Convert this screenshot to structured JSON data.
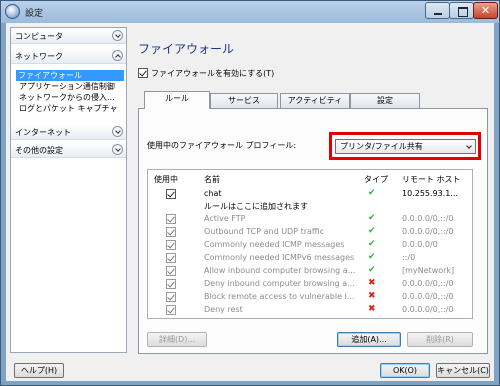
{
  "window": {
    "title": "設定"
  },
  "sidebar": {
    "sections": [
      {
        "label": "コンピュータ",
        "expanded": false
      },
      {
        "label": "ネットワーク",
        "expanded": true,
        "items": [
          "ファイアウォール",
          "アプリケーション通信制御",
          "ネットワークからの侵入...",
          "ログとパケット キャプチャ"
        ],
        "selected_index": 0
      },
      {
        "label": "インターネット",
        "expanded": false
      },
      {
        "label": "その他の設定",
        "expanded": false
      }
    ]
  },
  "main": {
    "title": "ファイアウォール",
    "enable_firewall": {
      "label": "ファイアウォールを有効にする(T)",
      "checked": true
    },
    "tabs": [
      "ルール",
      "サービス",
      "アクティビティ",
      "設定"
    ],
    "active_tab": 0,
    "profile": {
      "label": "使用中のファイアウォール プロフィール:",
      "value": "プリンタ/ファイル共有"
    },
    "rules": {
      "columns": [
        "使用中",
        "名前",
        "タイプ",
        "リモート ホスト"
      ],
      "rows": [
        {
          "enabled": true,
          "name": "chat",
          "type": "allow",
          "host": "10.255.93.1...",
          "editable": true
        },
        {
          "group_label": "ルールはここに追加されます"
        },
        {
          "enabled": true,
          "name": "Active FTP",
          "type": "allow",
          "host": "0.0.0.0/0,::/0",
          "editable": false
        },
        {
          "enabled": true,
          "name": "Outbound TCP and UDP traffic",
          "type": "allow",
          "host": "0.0.0.0/0,::/0",
          "editable": false
        },
        {
          "enabled": true,
          "name": "Commonly needed ICMP messages",
          "type": "allow",
          "host": "0.0.0.0/0",
          "editable": false
        },
        {
          "enabled": true,
          "name": "Commonly needed ICMPv6 messages",
          "type": "allow",
          "host": "::/0",
          "editable": false
        },
        {
          "enabled": true,
          "name": "Allow inbound computer browsing a...",
          "type": "allow",
          "host": "[myNetwork]",
          "editable": false
        },
        {
          "enabled": true,
          "name": "Deny inbound computer browsing a...",
          "type": "deny",
          "host": "0.0.0.0/0,::/0",
          "editable": false
        },
        {
          "enabled": true,
          "name": "Block remote access to vulnerable I...",
          "type": "deny",
          "host": "0.0.0.0/0,::/0",
          "editable": false
        },
        {
          "enabled": true,
          "name": "Deny rest",
          "type": "deny",
          "host": "0.0.0.0/0,::/0",
          "editable": false
        }
      ],
      "icons": {
        "allow": "✔",
        "deny": "✖"
      }
    },
    "buttons": {
      "details": "詳細(D)...",
      "add": "追加(A)...",
      "delete": "削除(R)"
    }
  },
  "footer": {
    "help": "ヘルプ(H)",
    "ok": "OK(O)",
    "cancel": "キャンセル(C)"
  }
}
